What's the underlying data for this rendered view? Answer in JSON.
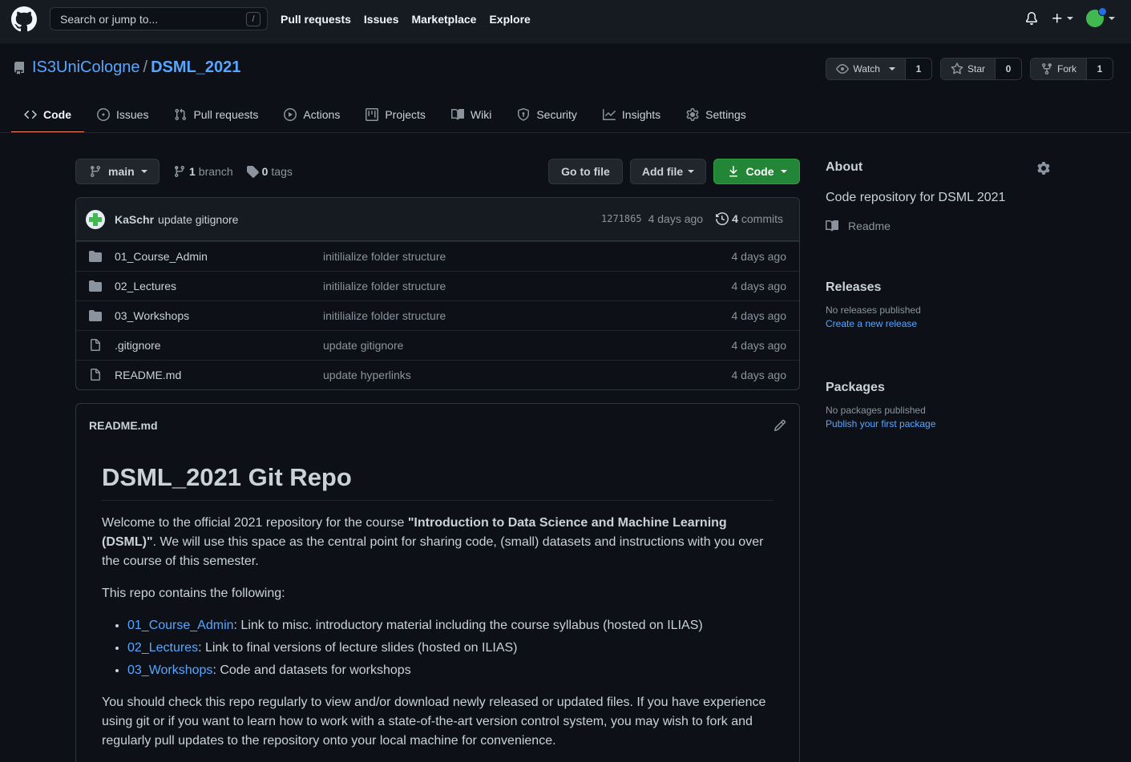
{
  "header": {
    "search_placeholder": "Search or jump to...",
    "search_shortcut": "/",
    "nav": [
      "Pull requests",
      "Issues",
      "Marketplace",
      "Explore"
    ]
  },
  "repo": {
    "owner": "IS3UniCologne",
    "separator": "/",
    "name": "DSML_2021",
    "watch_label": "Watch",
    "watch_count": "1",
    "star_label": "Star",
    "star_count": "0",
    "fork_label": "Fork",
    "fork_count": "1"
  },
  "tabs": [
    {
      "label": "Code",
      "icon": "code-icon"
    },
    {
      "label": "Issues",
      "icon": "issue-icon"
    },
    {
      "label": "Pull requests",
      "icon": "pull-request-icon"
    },
    {
      "label": "Actions",
      "icon": "play-icon"
    },
    {
      "label": "Projects",
      "icon": "project-icon"
    },
    {
      "label": "Wiki",
      "icon": "book-icon"
    },
    {
      "label": "Security",
      "icon": "shield-icon"
    },
    {
      "label": "Insights",
      "icon": "graph-icon"
    },
    {
      "label": "Settings",
      "icon": "gear-icon"
    }
  ],
  "branchbar": {
    "branch": "main",
    "branch_count": "1",
    "branch_label": "branch",
    "tag_count": "0",
    "tag_label": "tags",
    "goto_file": "Go to file",
    "add_file": "Add file",
    "code": "Code"
  },
  "commit": {
    "author": "KaSchr",
    "message": "update gitignore",
    "sha": "1271865",
    "date": "4 days ago",
    "commit_count": "4",
    "commit_label": "commits"
  },
  "files": [
    {
      "type": "folder",
      "name": "01_Course_Admin",
      "message": "initilialize folder structure",
      "date": "4 days ago"
    },
    {
      "type": "folder",
      "name": "02_Lectures",
      "message": "initilialize folder structure",
      "date": "4 days ago"
    },
    {
      "type": "folder",
      "name": "03_Workshops",
      "message": "initilialize folder structure",
      "date": "4 days ago"
    },
    {
      "type": "file",
      "name": ".gitignore",
      "message": "update gitignore",
      "date": "4 days ago"
    },
    {
      "type": "file",
      "name": "README.md",
      "message": "update hyperlinks",
      "date": "4 days ago"
    }
  ],
  "readme": {
    "filename": "README.md",
    "title": "DSML_2021 Git Repo",
    "p1_pre": "Welcome to the official 2021 repository for the course ",
    "p1_bold": "\"Introduction to Data Science and Machine Learning (DSML)\"",
    "p1_post": ". We will use this space as the central point for sharing code, (small) datasets and instructions with you over the course of this semester.",
    "p2": "This repo contains the following:",
    "list": [
      {
        "link": "01_Course_Admin",
        "text": ": Link to misc. introductory material including the course syllabus (hosted on ILIAS)"
      },
      {
        "link": "02_Lectures",
        "text": ": Link to final versions of lecture slides (hosted on ILIAS)"
      },
      {
        "link": "03_Workshops",
        "text": ": Code and datasets for workshops"
      }
    ],
    "p3": "You should check this repo regularly to view and/or download newly released or updated files. If you have experience using git or if you want to learn how to work with a state-of-the-art version control system, you may wish to fork and regularly pull updates to the repository onto your local machine for convenience."
  },
  "sidebar": {
    "about_title": "About",
    "description": "Code repository for DSML 2021",
    "readme_label": "Readme",
    "releases_title": "Releases",
    "releases_empty": "No releases published",
    "releases_link": "Create a new release",
    "packages_title": "Packages",
    "packages_empty": "No packages published",
    "packages_link": "Publish your first package"
  },
  "colors": {
    "background": "#0d1117",
    "header": "#161b22",
    "link": "#58a6ff",
    "green_button": "#238636",
    "active_tab_underline": "#f78166"
  }
}
